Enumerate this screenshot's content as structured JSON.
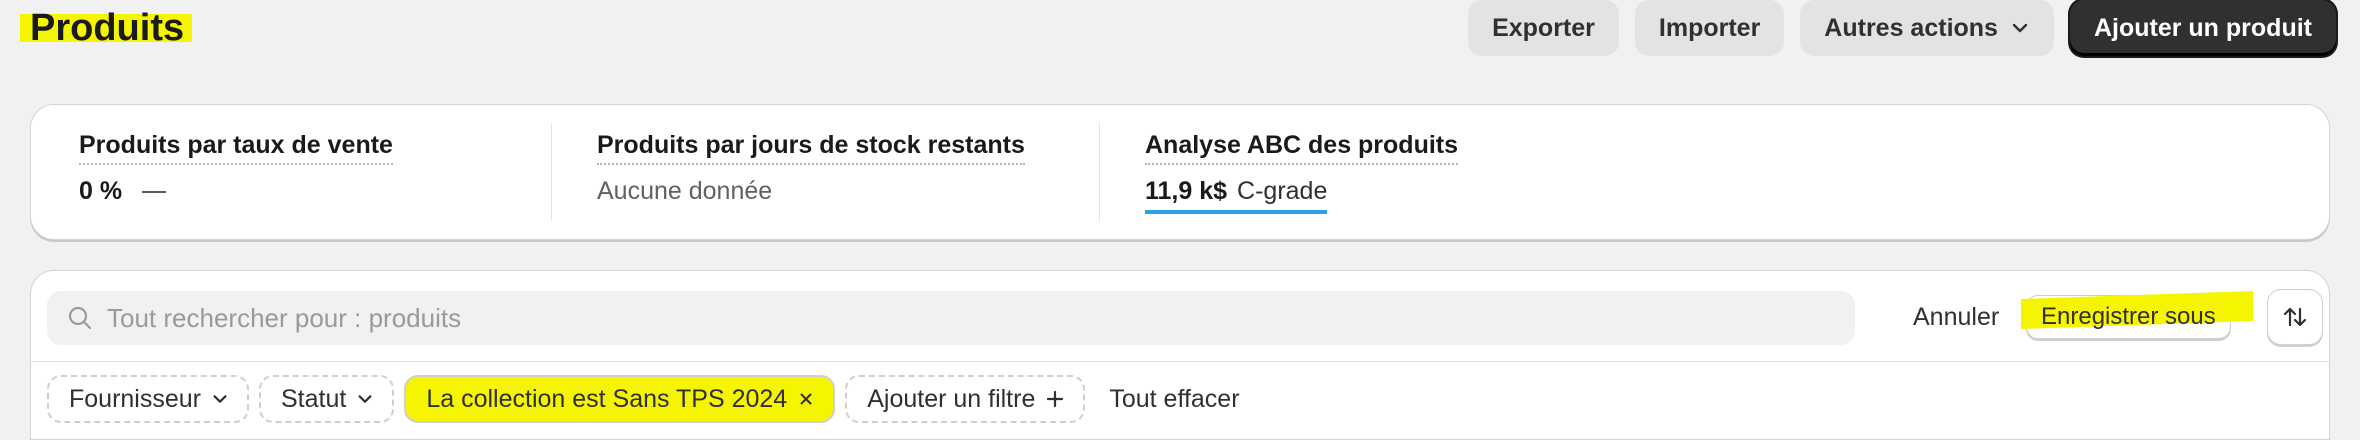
{
  "header": {
    "title": "Produits",
    "actions": {
      "export_label": "Exporter",
      "import_label": "Importer",
      "more_label": "Autres actions",
      "add_label": "Ajouter un produit"
    }
  },
  "analytics": {
    "sell_through": {
      "label": "Produits par taux de vente",
      "value": "0 %"
    },
    "days_of_stock": {
      "label": "Produits par jours de stock restants",
      "value": "Aucune donnée"
    },
    "abc": {
      "label": "Analyse ABC des produits",
      "value": "11,9 k$",
      "grade": "C-grade"
    }
  },
  "search": {
    "placeholder": "Tout rechercher pour : produits",
    "value": "",
    "cancel_label": "Annuler",
    "save_as_label": "Enregistrer sous"
  },
  "filters": {
    "supplier_label": "Fournisseur",
    "status_label": "Statut",
    "active_filter_label": "La collection est Sans TPS 2024",
    "add_filter_label": "Ajouter un filtre",
    "clear_all_label": "Tout effacer"
  },
  "colors": {
    "highlight": "#f5f500",
    "primary_button": "#303030",
    "abc_underline": "#2aa1e6",
    "page_background": "#f1f1f1"
  },
  "icons": {
    "more": "chevron-down-icon",
    "search": "search-icon",
    "sort": "sort-arrows-icon",
    "chip_dropdown": "chevron-down-icon",
    "remove_filter": "close-icon",
    "add_filter": "plus-icon"
  }
}
